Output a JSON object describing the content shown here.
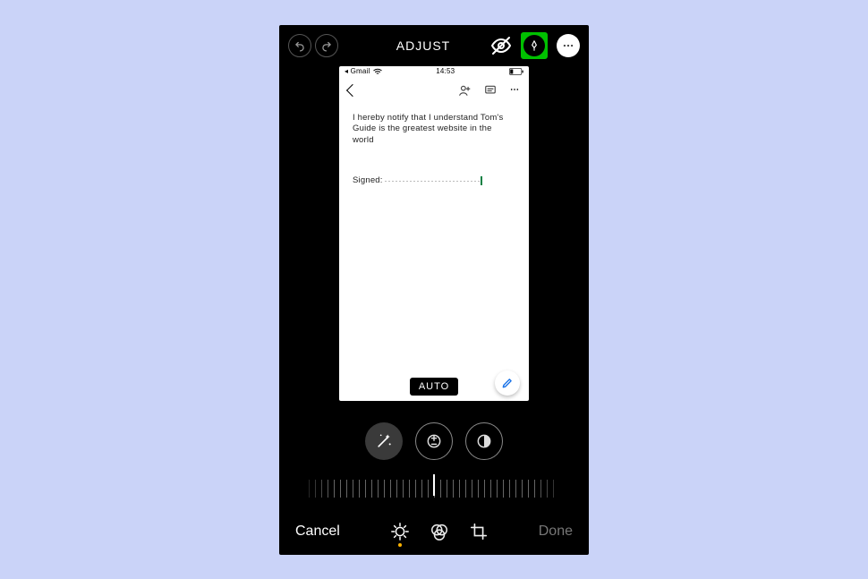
{
  "topbar": {
    "title": "ADJUST"
  },
  "icons": {
    "undo": "undo-icon",
    "redo": "redo-icon",
    "eye_off": "eye-off-icon",
    "markup": "markup-pen-icon",
    "more": "more-icon"
  },
  "inset": {
    "status": {
      "back_app": "◂ Gmail",
      "time": "14:53"
    },
    "doc": {
      "text": "I hereby notify that I understand Tom's Guide is the greatest website in the world",
      "signed_label": "Signed:"
    },
    "auto_label": "AUTO"
  },
  "tools": {
    "magic": "magic-wand-icon",
    "exposure": "exposure-icon",
    "brilliance": "brilliance-icon"
  },
  "bottom": {
    "cancel": "Cancel",
    "done": "Done"
  }
}
